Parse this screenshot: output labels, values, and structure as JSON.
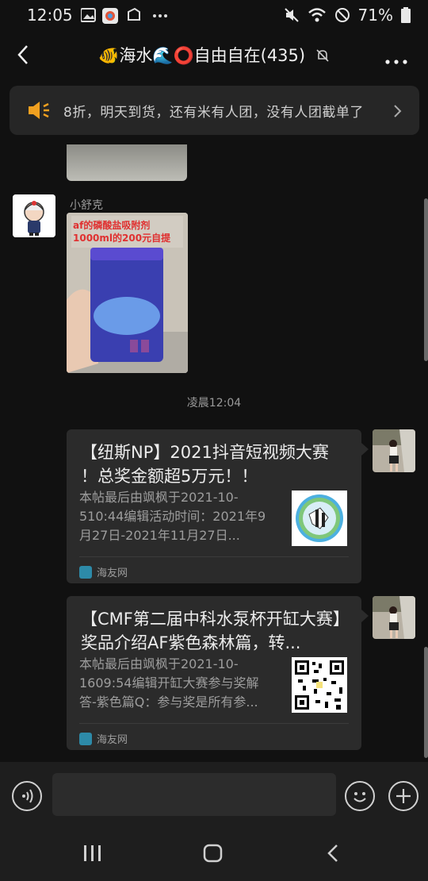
{
  "status_bar": {
    "time": "12:05",
    "battery": "71%"
  },
  "header": {
    "title": "🐠海水🌊⭕自由自在(435)"
  },
  "notice": {
    "text": "8折，明天到货，还有米有人团，没有人团截单了"
  },
  "messages": {
    "sender_name": "小舒克",
    "image_caption_line1": "af的磷酸盐吸附剂",
    "image_caption_line2": "1000ml的200元自提",
    "timestamp": "凌晨12:04"
  },
  "cards": [
    {
      "title": "【纽斯NP】2021抖音短视频大赛 ！总奖金额超5万元！！",
      "description": "本帖最后由飒枫于2021-10-510:44编辑活动时间：2021年9月27日-2021年11月27日...",
      "source": "海友网"
    },
    {
      "title": "【CMF第二届中科水泵杯开缸大赛】奖品介绍AF紫色森林篇，转...",
      "description": "本帖最后由飒枫于2021-10-1609:54编辑开缸大赛参与奖解答-紫色篇Q：参与奖是所有参...",
      "source": "海友网"
    }
  ],
  "icons": {
    "back": "back-arrow-icon",
    "more": "more-icon",
    "mute": "mute-icon",
    "speaker": "speaker-icon",
    "chevron": "chevron-right-icon",
    "voice": "voice-icon",
    "emoji": "emoji-icon",
    "plus": "plus-icon"
  },
  "colors": {
    "background": "#111111",
    "bubble": "#2b2b2b",
    "accent": "#f0a020"
  }
}
